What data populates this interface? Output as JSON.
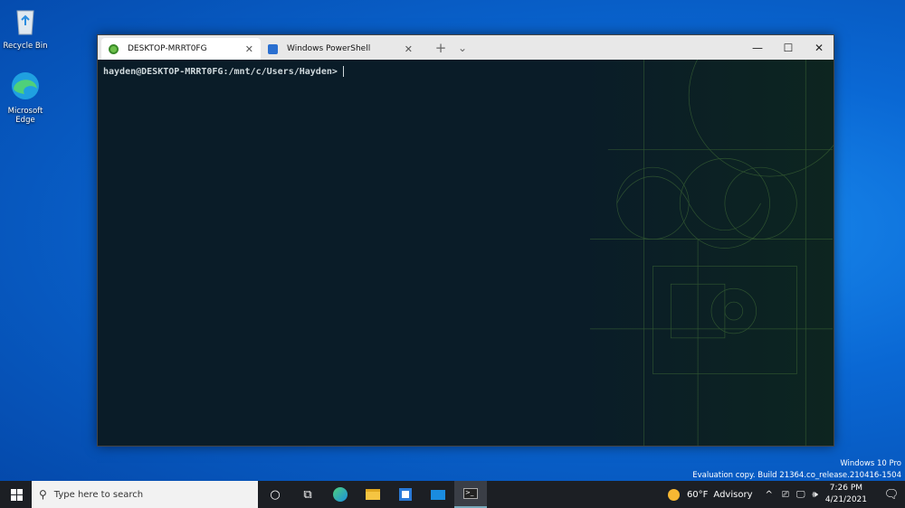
{
  "desktop": {
    "icons": [
      {
        "label": "Recycle Bin",
        "icon": "recycle-bin-icon"
      },
      {
        "label": "Microsoft Edge",
        "icon": "edge-icon"
      }
    ],
    "watermark": {
      "line1": "Windows 10 Pro",
      "line2": "Evaluation copy. Build 21364.co_release.210416-1504"
    }
  },
  "terminal": {
    "tabs": [
      {
        "label": "DESKTOP-MRRT0FG",
        "icon": "linux-icon",
        "active": true
      },
      {
        "label": "Windows PowerShell",
        "icon": "powershell-icon",
        "active": false
      }
    ],
    "new_tab": "+",
    "dropdown": "⌄",
    "minimize": "—",
    "maximize": "☐",
    "close": "✕",
    "prompt": "hayden@DESKTOP-MRRT0FG:/mnt/c/Users/Hayden>"
  },
  "taskbar": {
    "search_placeholder": "Type here to search",
    "weather": "60°F",
    "advisory": "Advisory",
    "time": "7:26 PM",
    "date": "4/21/2021",
    "pinned": [
      "cortana-icon",
      "task-view-icon",
      "edge-icon",
      "file-explorer-icon",
      "store-icon",
      "mail-icon",
      "terminal-icon"
    ]
  }
}
